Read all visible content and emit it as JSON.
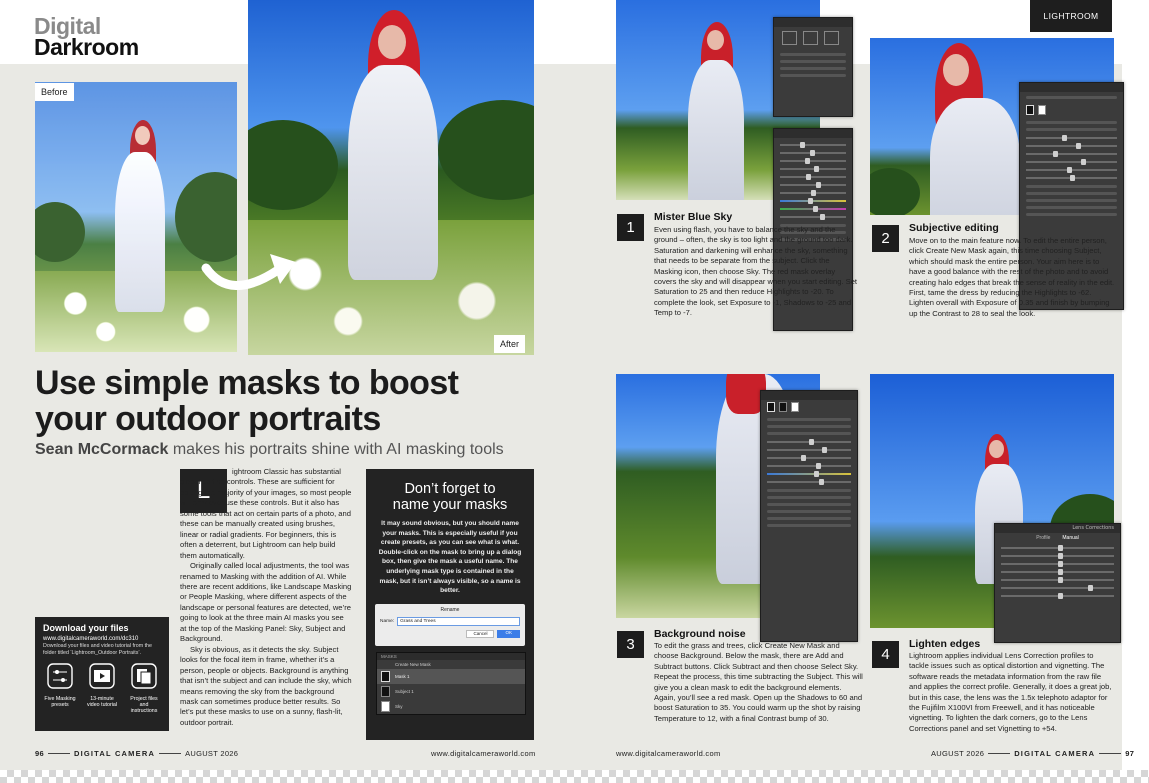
{
  "magazine": {
    "section_left": {
      "line1": "Digital",
      "line2": "Darkroom"
    },
    "section_right": "LIGHTROOM"
  },
  "hero": {
    "before_label": "Before",
    "after_label": "After",
    "headline": "Use simple masks to boost your outdoor portraits",
    "byline_name": "Sean McCormack",
    "byline_rest": "makes his portraits shine with AI masking tools"
  },
  "intro": {
    "dropcap": "L",
    "paragraph1": "ightroom Classic has substantial global editing controls. These are sufficient for editing the majority of your images, so most people will only ever use these controls. But it also has some tools that act on certain parts of a photo, and these can be manually created using brushes, linear or radial gradients. For beginners, this is often a deterrent, but Lightroom can help build them automatically.",
    "paragraph2": "Originally called local adjustments, the tool was renamed to Masking with the addition of AI. While there are recent additions, like Landscape Masking or People Masking, where different aspects of the landscape or personal features are detected, we’re going to look at the three main AI masks you see at the top of the Masking Panel: Sky, Subject and Background.",
    "paragraph3": "Sky is obvious, as it detects the sky. Subject looks for the focal item in frame, whether it’s a person, people or objects. Background is anything that isn’t the subject and can include the sky, which means removing the sky from the background mask can sometimes produce better results. So let’s put these masks to use on a sunny, flash-lit, outdoor portrait."
  },
  "download": {
    "title": "Download your files",
    "url": "www.digitalcameraworld.com/dc310",
    "description": "Download your files and video tutorial from the folder titled ‘Lightroom_Outdoor Portraits’.",
    "items": [
      {
        "icon": "sliders-icon",
        "label": "Five Masking presets"
      },
      {
        "icon": "play-icon",
        "label": "13-minute video tutorial"
      },
      {
        "icon": "files-icon",
        "label": "Project files and instructions"
      }
    ]
  },
  "tip": {
    "title": "Don’t forget to name your masks",
    "body": "It may sound obvious, but you should name your masks. This is especially useful if you create presets, as you can see what is what. Double-click on the mask to bring up a dialog box, then give the mask a useful name. The underlying mask type is contained in the mask, but it isn’t always visible, so a name is better.",
    "dialog": {
      "title": "Rename",
      "field_label": "Name:",
      "field_value": "Grass and Trees",
      "cancel": "Cancel",
      "ok": "OK"
    },
    "masks_panel": {
      "header": "MASKS",
      "create": "Create New Mask",
      "items": [
        "Mask 1",
        "Subject 1",
        "Sky"
      ]
    }
  },
  "steps": [
    {
      "num": "1",
      "title": "Mister Blue Sky",
      "body": "Even using flash, you have to balance the sky and the ground – often, the sky is too light and the ground too dark. Saturation and darkening will enhance the sky, something that needs to be separate from the subject. Click the Masking icon, then choose Sky. The red mask overlay covers the sky and will disappear when you start editing. Set Saturation to 25 and then reduce Highlights to -20. To complete the look, set Exposure to -1, Shadows to -25 and Temp to -7."
    },
    {
      "num": "2",
      "title": "Subjective editing",
      "body": "Move on to the main feature now. To edit the entire person, click Create New Mask again, this time choosing Subject, which should mask the entire person. Your aim here is to have a good balance with the rest of the photo and to avoid creating halo edges that break the sense of reality in the edit. First, tame the dress by reducing the Highlights to -62. Lighten overall with Exposure of 0.35 and finish by bumping up the Contrast to 28 to seal the look."
    },
    {
      "num": "3",
      "title": "Background noise",
      "body": "To edit the grass and trees, click Create New Mask and choose Background. Below the mask, there are Add and Subtract buttons. Click Subtract and then choose Select Sky. Repeat the process, this time subtracting the Subject. This will give you a clean mask to edit the background elements. Again, you’ll see a red mask. Open up the Shadows to 60 and boost Saturation to 35. You could warm up the shot by raising Temperature to 12, with a final Contrast bump of 30."
    },
    {
      "num": "4",
      "title": "Lighten edges",
      "body": "Lightroom applies individual Lens Correction profiles to tackle issues such as optical distortion and vignetting. The software reads the metadata information from the raw file and applies the correct profile. Generally, it does a great job, but in this case, the lens was the 1.5x telephoto adaptor for the Fujifilm X100VI from Freewell, and it has noticeable vignetting. To lighten the dark corners, go to the Lens Corrections panel and set Vignetting to +54."
    }
  ],
  "panels": {
    "lens_title": "Lens Corrections",
    "lens_tabs": [
      "Profile",
      "Manual"
    ]
  },
  "footer": {
    "left_page": "96",
    "magazine_name": "DIGITAL CAMERA",
    "issue": "AUGUST 2026",
    "website": "www.digitalcameraworld.com",
    "right_page": "97"
  }
}
